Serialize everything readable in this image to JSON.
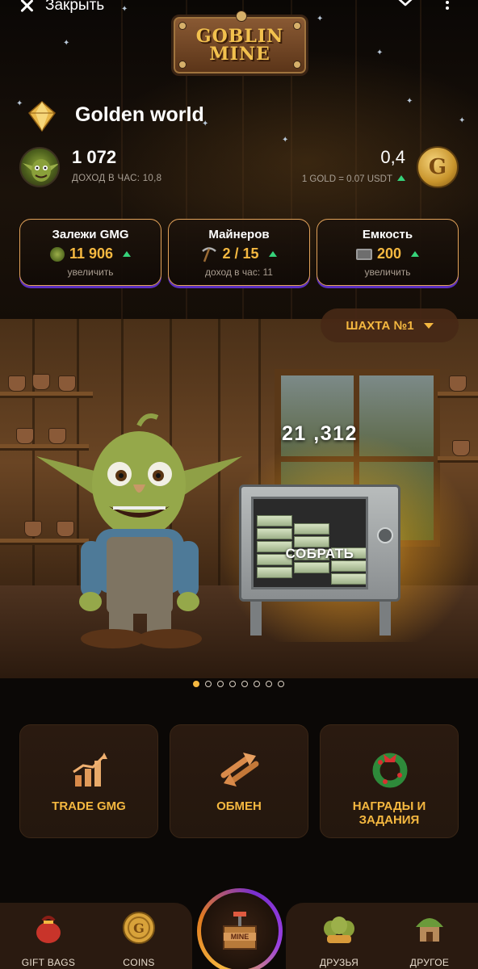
{
  "topbar": {
    "close_label": "Закрыть"
  },
  "logo": {
    "line1": "GOBLIN",
    "line2": "MINE"
  },
  "profile": {
    "world_name": "Golden world",
    "score": "1 072",
    "income_label": "ДОХОД В ЧАС:",
    "income_value": "10,8",
    "gold_value": "0,4",
    "gold_rate": "1 GOLD = 0.07 USDT",
    "coin_letter": "G"
  },
  "stats": [
    {
      "title": "Залежи GMG",
      "value": "11 906",
      "sub": "увеличить"
    },
    {
      "title": "Майнеров",
      "value": "2 / 15",
      "sub": "доход в час: 11"
    },
    {
      "title": "Емкость",
      "value": "200",
      "sub": "увеличить"
    }
  ],
  "mine_select": {
    "label": "ШАХТА №1"
  },
  "scene": {
    "counter": "21 ,312",
    "collect_label": "СОБРАТЬ"
  },
  "carousel": {
    "total": 8,
    "active": 0
  },
  "actions": [
    {
      "label": "TRADE GMG",
      "icon": "chart-up-icon"
    },
    {
      "label": "ОБМЕН",
      "icon": "exchange-arrows-icon"
    },
    {
      "label": "НАГРАДЫ И ЗАДАНИЯ",
      "icon": "wreath-icon"
    }
  ],
  "nav": {
    "gift_bags": "GIFT BAGS",
    "coins": "COINS",
    "center_label": "MINE",
    "friends": "ДРУЗЬЯ",
    "other": "ДРУГОЕ"
  },
  "colors": {
    "accent": "#f5b840",
    "up": "#36d27a",
    "card_border": "#e3a35a",
    "card_shadow": "#5a2fbf"
  }
}
